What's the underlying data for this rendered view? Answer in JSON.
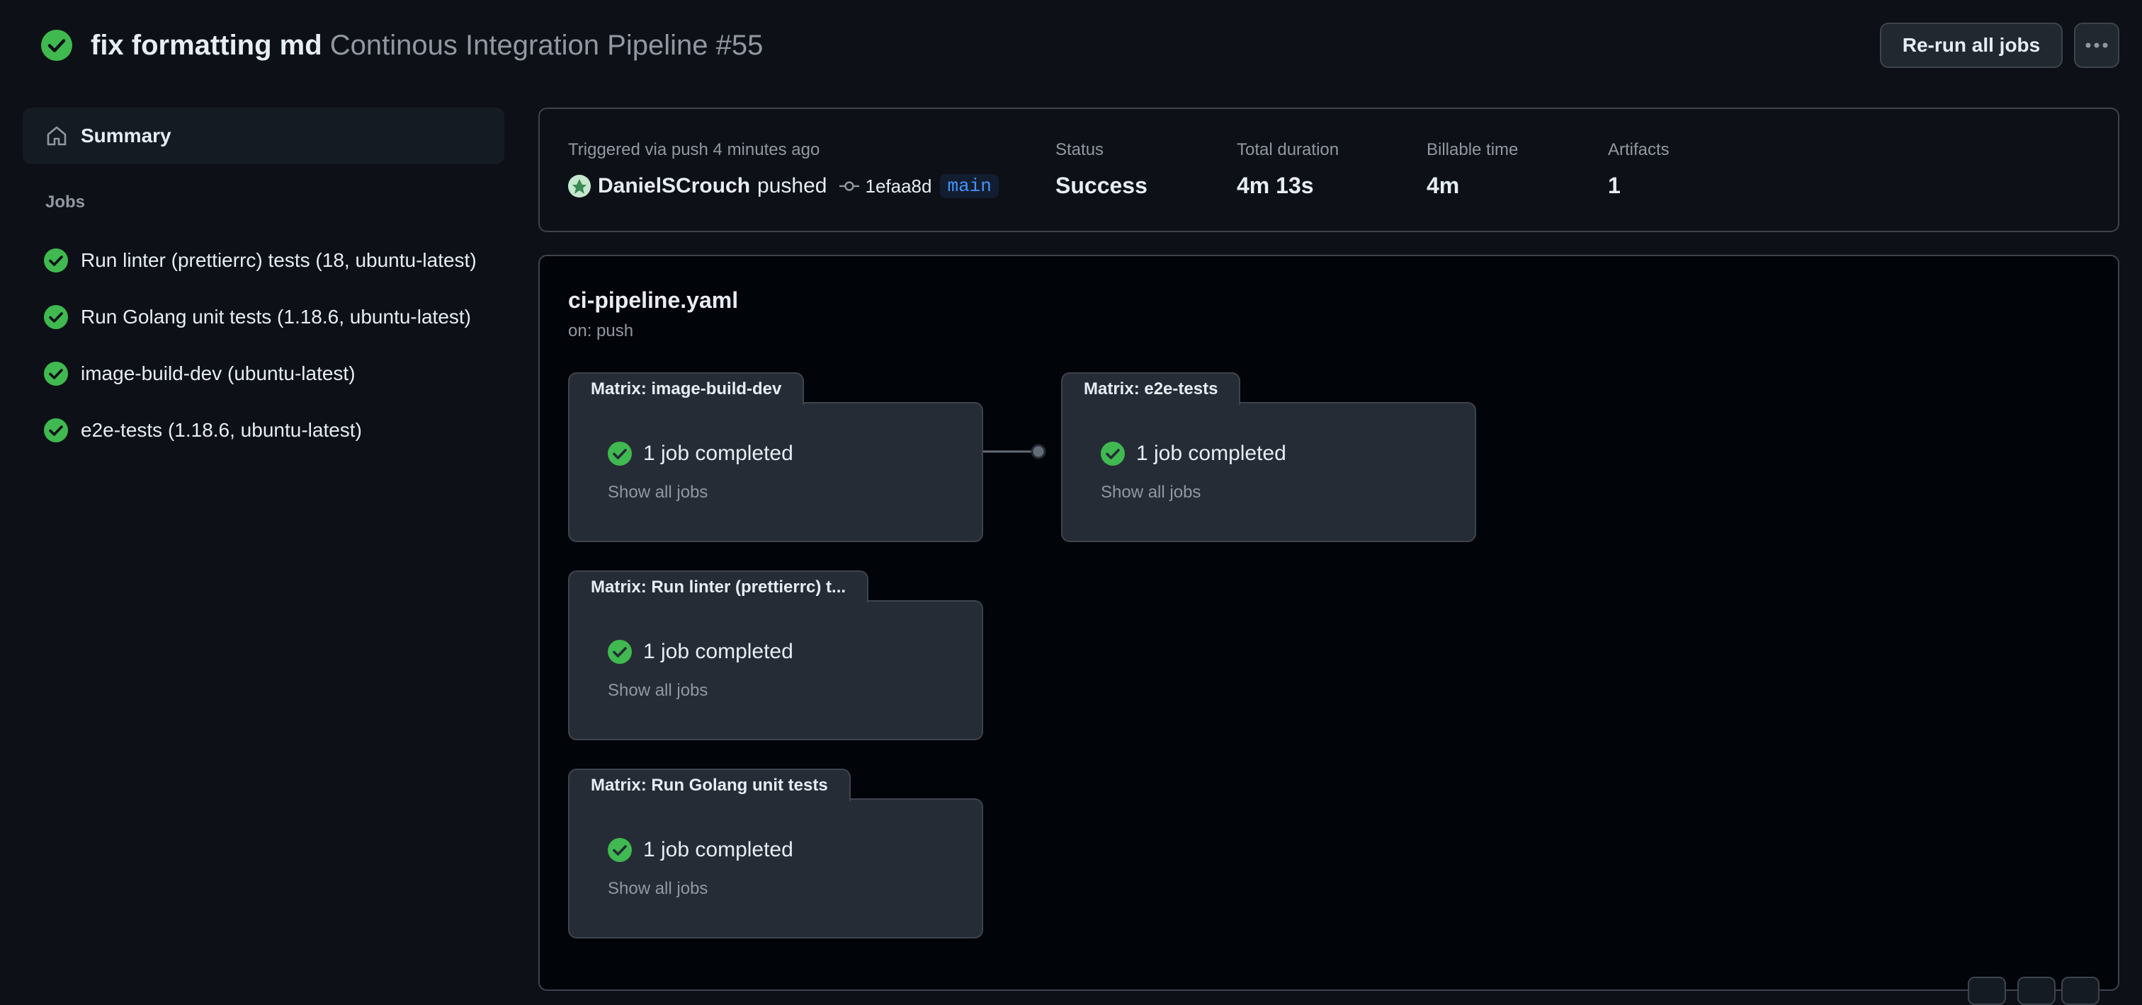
{
  "header": {
    "title_bold": "fix formatting md",
    "title_light": "Continous Integration Pipeline #55",
    "rerun_label": "Re-run all jobs",
    "more_icon": "kebab-horizontal-icon"
  },
  "sidebar": {
    "summary_label": "Summary",
    "jobs_heading": "Jobs",
    "jobs": [
      {
        "label": "Run linter (prettierrc) tests (18, ubuntu-latest)",
        "status": "success"
      },
      {
        "label": "Run Golang unit tests (1.18.6, ubuntu-latest)",
        "status": "success"
      },
      {
        "label": "image-build-dev (ubuntu-latest)",
        "status": "success"
      },
      {
        "label": "e2e-tests (1.18.6, ubuntu-latest)",
        "status": "success"
      }
    ]
  },
  "run_info": {
    "trigger": "Triggered via push 4 minutes ago",
    "actor": "DanielSCrouch",
    "action": "pushed",
    "sha": "1efaa8d",
    "branch": "main",
    "status_label": "Status",
    "status_value": "Success",
    "duration_label": "Total duration",
    "duration_value": "4m 13s",
    "billable_label": "Billable time",
    "billable_value": "4m",
    "artifacts_label": "Artifacts",
    "artifacts_value": "1"
  },
  "workflow": {
    "file": "ci-pipeline.yaml",
    "on": "on: push",
    "matrices": [
      {
        "title": "Matrix: image-build-dev",
        "status_text": "1 job completed",
        "show_all": "Show all jobs"
      },
      {
        "title": "Matrix: e2e-tests",
        "status_text": "1 job completed",
        "show_all": "Show all jobs"
      },
      {
        "title": "Matrix: Run linter (prettierrc) t...",
        "status_text": "1 job completed",
        "show_all": "Show all jobs"
      },
      {
        "title": "Matrix: Run Golang unit tests",
        "status_text": "1 job completed",
        "show_all": "Show all jobs"
      }
    ]
  },
  "colors": {
    "background": "#0d1117",
    "graph_background": "#010409",
    "success": "#3fb950",
    "branch": "#4493f8",
    "muted": "#9198a1"
  }
}
